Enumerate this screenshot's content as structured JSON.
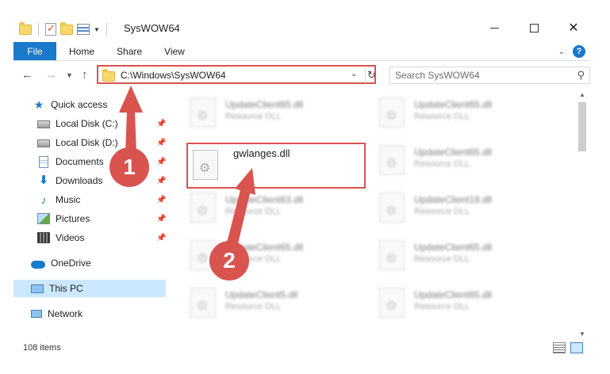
{
  "window": {
    "title": "SysWOW64"
  },
  "ribbon": {
    "tabs": [
      "File",
      "Home",
      "Share",
      "View"
    ]
  },
  "address": {
    "path": "C:\\Windows\\SysWOW64",
    "search_placeholder": "Search SysWOW64"
  },
  "sidebar": {
    "items": [
      {
        "label": "Quick access"
      },
      {
        "label": "Local Disk (C:)"
      },
      {
        "label": "Local Disk (D:)"
      },
      {
        "label": "Documents"
      },
      {
        "label": "Downloads"
      },
      {
        "label": "Music"
      },
      {
        "label": "Pictures"
      },
      {
        "label": "Videos"
      },
      {
        "label": "OneDrive"
      },
      {
        "label": "This PC"
      },
      {
        "label": "Network"
      }
    ]
  },
  "files": {
    "left": [
      {
        "name": "UpdateClient65.dll",
        "type": "Resource DLL"
      },
      {
        "name": "gwlanges.dll",
        "type": ""
      },
      {
        "name": "UpdateClient63.dll",
        "type": "Resource DLL"
      },
      {
        "name": "UpdateClient65.dll",
        "type": "Resource DLL"
      },
      {
        "name": "UpdateClient5.dll",
        "type": "Resource DLL"
      }
    ],
    "right": [
      {
        "name": "UpdateClient65.dll",
        "type": "Resource DLL"
      },
      {
        "name": "UpdateClient65.dll",
        "type": "Resource DLL"
      },
      {
        "name": "UpdateClient19.dll",
        "type": "Resource DLL"
      },
      {
        "name": "UpdateClient65.dll",
        "type": "Resource DLL"
      },
      {
        "name": "UpdateClient65.dll",
        "type": "Resource DLL"
      }
    ]
  },
  "status": {
    "item_count": "108 items"
  },
  "annotations": {
    "step1": "1",
    "step2": "2"
  },
  "colors": {
    "accent": "#1979ca",
    "highlight": "#d9534f",
    "selection": "#cce8ff"
  }
}
